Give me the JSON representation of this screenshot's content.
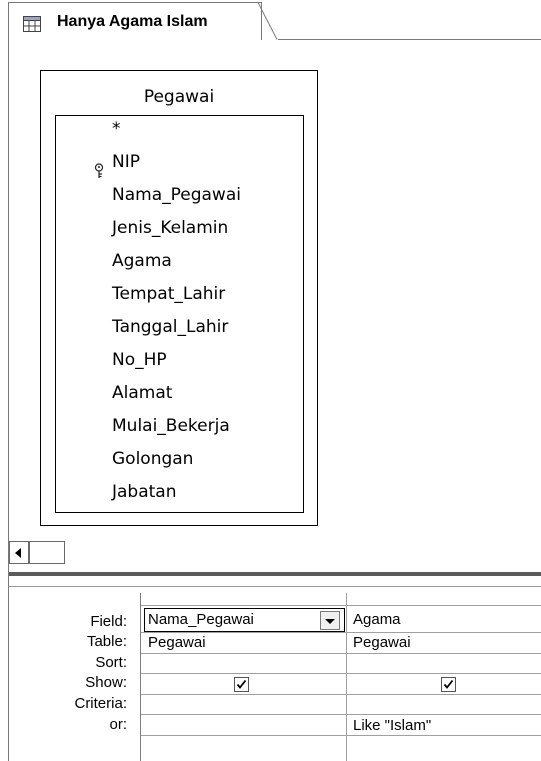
{
  "tab": {
    "title": "Hanya Agama Islam",
    "icon": "query-design-icon"
  },
  "table_window": {
    "title": "Pegawai",
    "primary_key_icon": "key-icon",
    "fields": [
      "*",
      "NIP",
      "Nama_Pegawai",
      "Jenis_Kelamin",
      "Agama",
      "Tempat_Lahir",
      "Tanggal_Lahir",
      "No_HP",
      "Alamat",
      "Mulai_Bekerja",
      "Golongan",
      "Jabatan"
    ]
  },
  "grid": {
    "row_labels": {
      "field": "Field:",
      "table": "Table:",
      "sort": "Sort:",
      "show": "Show:",
      "criteria": "Criteria:",
      "or": "or:"
    },
    "columns": [
      {
        "field": "Nama_Pegawai",
        "table": "Pegawai",
        "sort": "",
        "show": true,
        "criteria": "",
        "or": ""
      },
      {
        "field": "Agama",
        "table": "Pegawai",
        "sort": "",
        "show": true,
        "criteria": "Like \"Islam\"",
        "or": ""
      }
    ]
  }
}
